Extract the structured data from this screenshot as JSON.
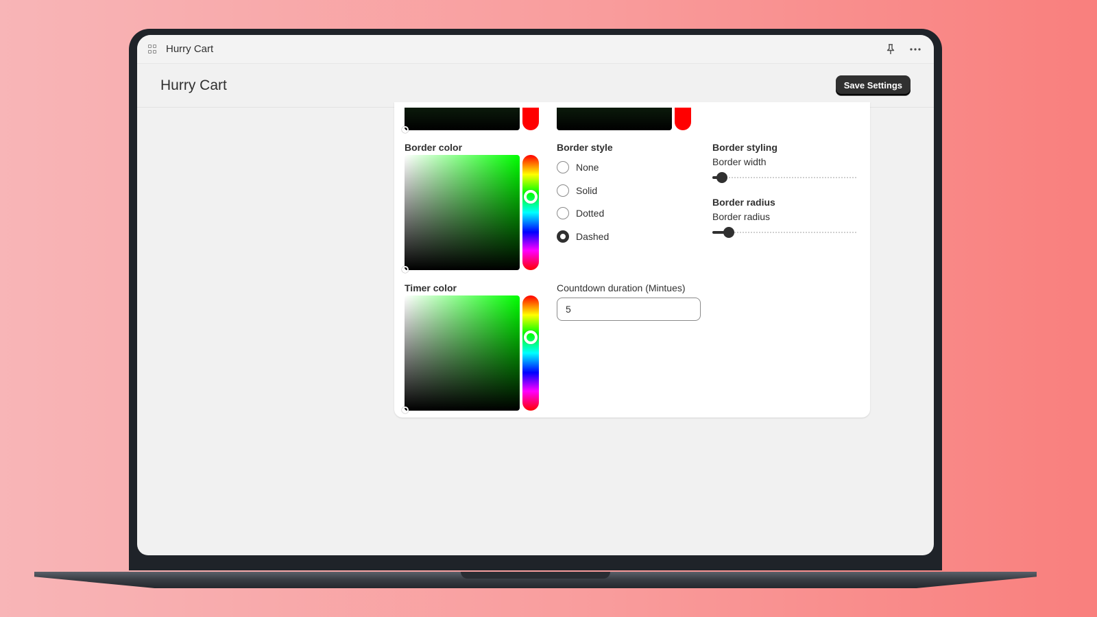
{
  "app": {
    "title": "Hurry Cart",
    "pin_icon": "pin-icon",
    "more_icon": "more-horizontal-icon"
  },
  "header": {
    "title": "Hurry Cart",
    "save_label": "Save Settings"
  },
  "colors": {
    "background_left": "#f8b5b7",
    "background_right": "#f97f7d",
    "primary_button": "#303030",
    "selected_hue": "#00ff00"
  },
  "settings": {
    "border_color": {
      "label": "Border color",
      "hue": "#00ff00"
    },
    "timer_color": {
      "label": "Timer color",
      "hue": "#00ff00"
    },
    "border_style": {
      "label": "Border style",
      "options": [
        "None",
        "Solid",
        "Dotted",
        "Dashed"
      ],
      "selected": "Dashed"
    },
    "border_styling": {
      "label": "Border styling",
      "width_label": "Border width",
      "width_value_fraction": 0.03
    },
    "border_radius": {
      "label": "Border radius",
      "sublabel": "Border radius",
      "value_fraction": 0.08
    },
    "countdown": {
      "label": "Countdown duration (Mintues)",
      "value": "5"
    }
  }
}
